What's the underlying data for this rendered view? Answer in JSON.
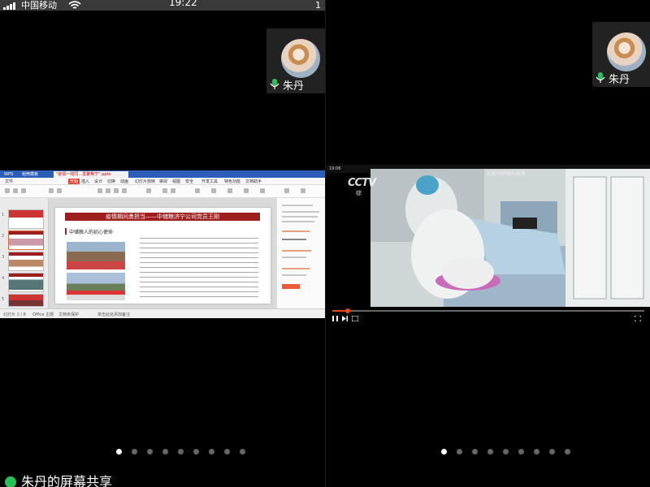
{
  "status_bar": {
    "carrier": "中国移动",
    "time": "19:22",
    "right_fragment": "1"
  },
  "participant": {
    "name": "朱丹"
  },
  "left_share": {
    "app_tabs": [
      "WPS",
      "稻壳模板",
      "\"疫情一线同…爱聚焦宁\".pptx"
    ],
    "menu_items": [
      "文件",
      "开始",
      "插入",
      "设计",
      "切换",
      "动画",
      "幻灯片放映",
      "审阅",
      "视图",
      "安全",
      "开发工具",
      "特色功能",
      "文档助手"
    ],
    "active_menu": "开始",
    "slide_title": "疫情期间勇担当——中储粮济宁公司党员王刚",
    "slide_subtitle": "中储粮人的初心使命",
    "thumbnail_numbers": [
      "1",
      "2",
      "3",
      "4",
      "5"
    ],
    "status_items": [
      "幻灯片 2 / 8",
      "Office 主题",
      "文档未保护",
      "单击此处添加备注"
    ]
  },
  "right_share": {
    "channel_logo": "CCTV",
    "channel_sub": "综",
    "caption": "抗疫中的镜头故事",
    "time_left": "19:06",
    "progress": 0.05
  },
  "left_pager": {
    "count": 9,
    "active": 0
  },
  "right_pager": {
    "count": 9,
    "active": 0
  },
  "share_label": "朱丹的屏幕共享",
  "colors": {
    "slide_title_bg": "#9e1d1d",
    "wps_accent": "#d94a38",
    "progress": "#e64a19",
    "mic_green": "#2bbf5a"
  }
}
